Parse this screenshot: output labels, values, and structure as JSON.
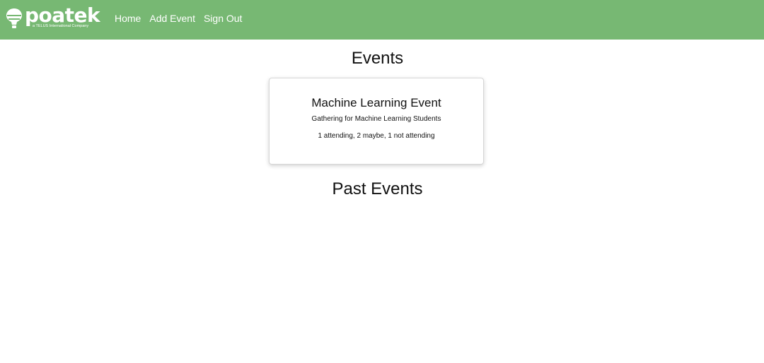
{
  "navbar": {
    "background": "#77b873",
    "brand": {
      "name": "poatek",
      "tagline": "a TELUS International Company",
      "icon": "balloon-icon"
    },
    "links": [
      {
        "label": "Home"
      },
      {
        "label": "Add Event"
      },
      {
        "label": "Sign Out"
      }
    ]
  },
  "main": {
    "title": "Events",
    "events": [
      {
        "title": "Machine Learning Event",
        "description": "Gathering for Machine Learning Students",
        "rsvp": "1 attending, 2 maybe, 1 not attending"
      }
    ],
    "past_title": "Past Events"
  }
}
